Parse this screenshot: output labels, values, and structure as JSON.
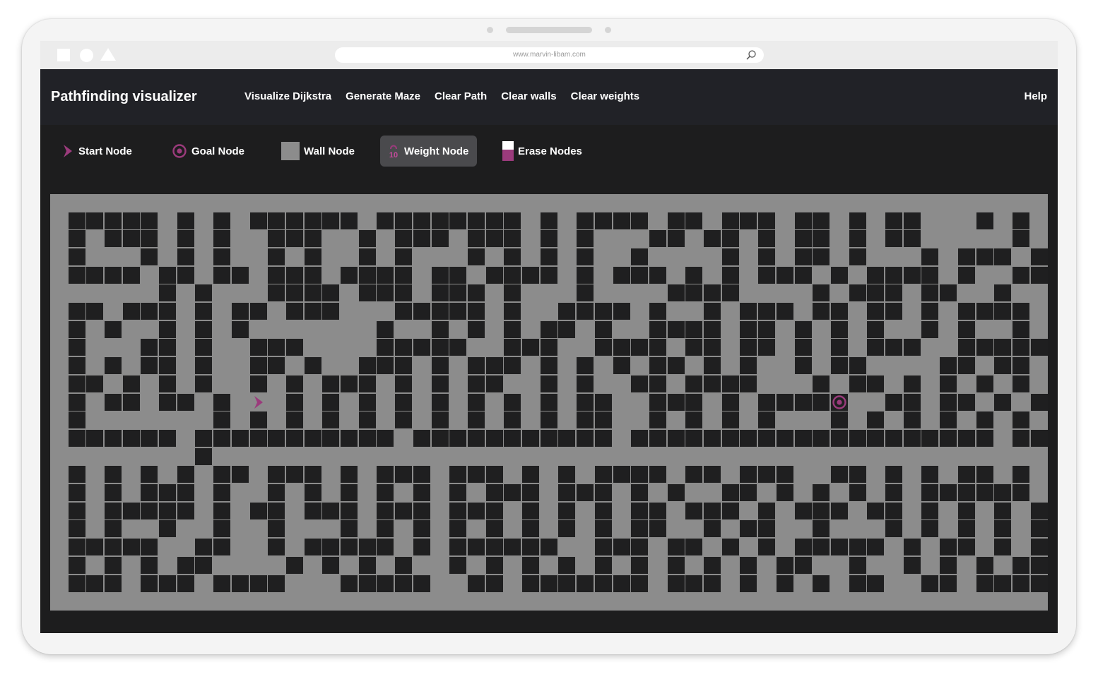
{
  "browser": {
    "url": "www.marvin-libam.com"
  },
  "navbar": {
    "brand": "Pathfinding visualizer",
    "links": [
      "Visualize Dijkstra",
      "Generate Maze",
      "Clear Path",
      "Clear walls",
      "Clear weights"
    ],
    "help": "Help"
  },
  "legend": {
    "items": [
      {
        "label": "Start Node",
        "icon": "chevron-right-icon"
      },
      {
        "label": "Goal Node",
        "icon": "target-icon"
      },
      {
        "label": "Wall Node",
        "icon": "wall-square-icon"
      },
      {
        "label": "Weight Node",
        "icon": "weight-icon",
        "weight_value": "10",
        "active": true
      },
      {
        "label": "Erase Nodes",
        "icon": "eraser-icon"
      }
    ]
  },
  "colors": {
    "accent": "#9b3b7c",
    "wall": "#1f1f20",
    "empty": "#8c8c8c",
    "navbar": "#212227",
    "panel": "#1d1d1e"
  },
  "grid": {
    "cols": 55,
    "rows": 23,
    "start": {
      "row": 11,
      "col": 11
    },
    "goal": {
      "row": 11,
      "col": 43
    },
    "maze": [
      ".......................................................",
      ".#####.#.#.######.########.#.####.##.###.##.#.##...#.#.",
      ".#.###.#.#..###..#.###.###.#.#...##.##.#.##.#.##.....#.",
      ".#...#.#.#..#.#..#.#...#.#.#.#..#....#.#.##.#...#.###.#",
      ".####.##.##.###.####.##.####.#.###.#.#.###.#.####.#..##",
      "......#.#...####.###.###.#...#....####....#.###.##..#..",
      ".##.###.#.##.###...#####.#..####.#..#.###.##.##.#.####.",
      ".#.#..#.#.#.......#..#.#.#.##.#..####.##.#.#.#..#.#..#.",
      ".#...##.#..###....#####..###..####.##.##.#.#.###..#####",
      ".#.#.##.#..##.#..###.#.###.#.#.#.##.#.#..#.##....##.##.",
      ".##.#.#.#..#.#.###.#.#.##..#.#..##.####...#.##.#.#.#.#.",
      ".#.##.##.#.>.#.#.#.#.#.#.#.#.##..###.#.#####..##.##.#.#",
      ".#.......#.#.#.#.#.#.#.#.#.#.##..#.#.#.#...#.#.#.#.#.#.",
      ".######.###########.###########.####################.##",
      "........#..............................................",
      ".#.#.#.#.##.###.#.###.###.#.#.####.##.###..##.#.#.##.#.",
      ".#.#.###.#..#.#.#.#.#.#.###.###.#.#..##.#.#.#.#.######.",
      ".#.#####.#.##.###.###.###.#.#.#.##.###.#.###.##.#.#.#.#",
      ".#.#..#..#..#...#.#.#.#.#.#.#.#.##..#.##..#...#.#.#.#.#",
      ".#####..##..#.#####.#.######..###.##.#.#.#####.#.##.#.#",
      ".#.#.#.##....#.#.#.#..#.#.#.#.#.#.#.#.#.##..#..#.#.#.##",
      ".###.###.####...#####..##.#######.###.#.#.#.##..##.####",
      "......................................................."
    ]
  }
}
